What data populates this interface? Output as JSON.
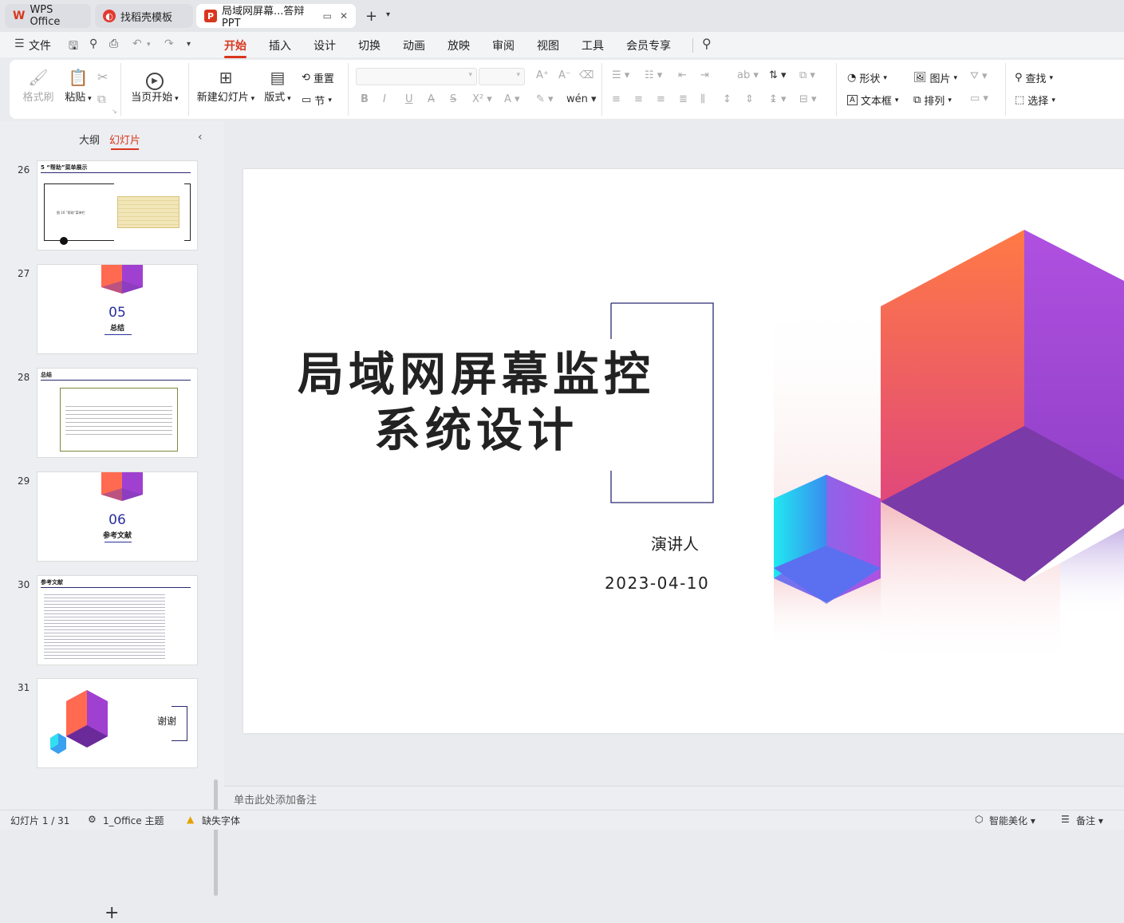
{
  "tabs": {
    "app": "WPS Office",
    "template": "找稻壳模板",
    "document": "局域网屏幕...答辩PPT"
  },
  "menu": {
    "file": "文件",
    "items": [
      "开始",
      "插入",
      "设计",
      "切换",
      "动画",
      "放映",
      "审阅",
      "视图",
      "工具",
      "会员专享"
    ],
    "active": "开始"
  },
  "ribbon": {
    "format_painter": "格式刷",
    "paste": "粘贴",
    "from_current": "当页开始",
    "new_slide": "新建幻灯片",
    "layout": "版式",
    "reset": "重置",
    "section": "节",
    "shape": "形状",
    "picture": "图片",
    "textbox": "文本框",
    "arrange": "排列",
    "find": "查找",
    "select": "选择"
  },
  "left_panel": {
    "outline_tab": "大纲",
    "slides_tab": "幻灯片",
    "thumbnails": [
      {
        "num": "26",
        "title": "5 “帮助”菜单展示",
        "caption": "图 16 “帮助”菜单栏"
      },
      {
        "num": "27",
        "section_no": "05",
        "section_title": "总结"
      },
      {
        "num": "28",
        "title": "总结"
      },
      {
        "num": "29",
        "section_no": "06",
        "section_title": "参考文献"
      },
      {
        "num": "30",
        "title": "参考文献"
      },
      {
        "num": "31",
        "thanks": "谢谢"
      }
    ]
  },
  "slide": {
    "title_line1": "局域网屏幕监控",
    "title_line2": "系统设计",
    "presenter": "演讲人",
    "date": "2023-04-10"
  },
  "notes_placeholder": "单击此处添加备注",
  "status": {
    "slide_counter": "幻灯片 1 / 31",
    "theme": "1_Office 主题",
    "missing_font": "缺失字体",
    "smart_beautify": "智能美化",
    "notes": "备注"
  },
  "colors": {
    "accent": "#d9361e",
    "frame": "#2a2870",
    "section_blue": "#2a2f9c"
  }
}
